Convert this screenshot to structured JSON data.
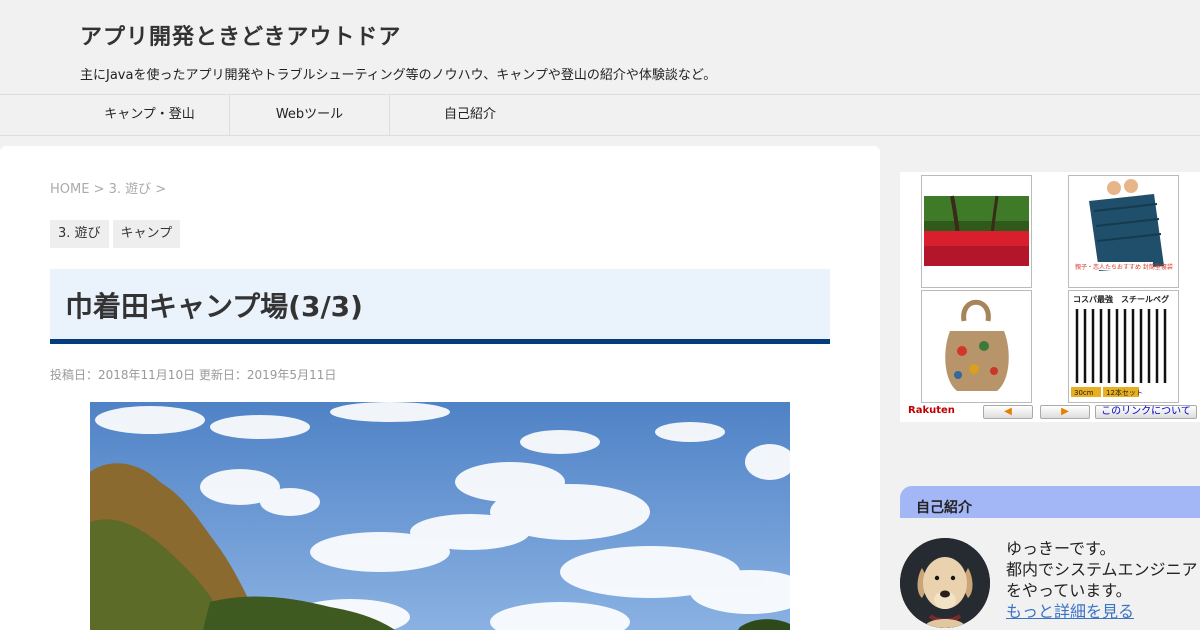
{
  "site": {
    "title": "アプリ開発ときどきアウトドア",
    "description": "主にJavaを使ったアプリ開発やトラブルシューティング等のノウハウ、キャンプや登山の紹介や体験談など。"
  },
  "nav": {
    "items": [
      {
        "label": "キャンプ・登山"
      },
      {
        "label": "Webツール"
      },
      {
        "label": "自己紹介"
      }
    ]
  },
  "article": {
    "breadcrumb": {
      "home": "HOME",
      "sep1": " > ",
      "category": "3. 遊び",
      "sep2": " >"
    },
    "categories": [
      "3. 遊び",
      "キャンプ"
    ],
    "title": "巾着田キャンプ場(3/3)",
    "dates": "投稿日：2018年11月10日 更新日：2019年5月11日"
  },
  "sidebar": {
    "rakuten": {
      "logo": "Rakuten",
      "prev": "◀",
      "next": "▶",
      "about": "このリンクについて",
      "ad2_caption": "親子・恋人たちおすすめ 封筒型寝袋",
      "ad4_caption_top": "コスパ最強　スチールペグ",
      "ad4_caption_b1": "30cm",
      "ad4_caption_b2": "12本セット"
    },
    "profile": {
      "heading": "自己紹介",
      "line1": "ゆっきーです。",
      "line2": "都内でシステムエンジニア",
      "line3": "をやっています。",
      "link": "もっと詳細を見る"
    }
  },
  "colors": {
    "title_bar_bg": "#eaf2fc",
    "title_bar_border": "#043d7c",
    "profile_head_bg": "#a3b7f6",
    "link": "#3a72c4"
  }
}
